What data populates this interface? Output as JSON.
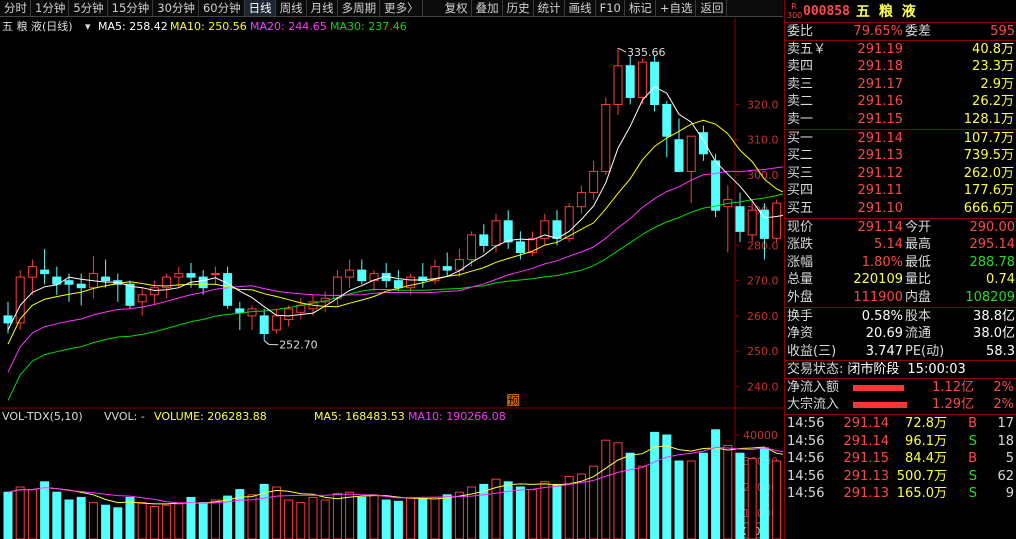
{
  "toolbar": {
    "left": [
      "分时",
      "1分钟",
      "5分钟",
      "15分钟",
      "30分钟",
      "60分钟",
      "日线",
      "周线",
      "月线",
      "多周期",
      "更多〉"
    ],
    "active": "日线",
    "right": [
      "复权",
      "叠加",
      "历史",
      "统计",
      "画线",
      "F10",
      "标记",
      "+自选",
      "返回"
    ]
  },
  "chart": {
    "header": {
      "name": "五 粮 液(日线)",
      "ma5": "MA5: 258.42",
      "ma10": "MA10: 250.56",
      "ma20": "MA20: 244.65",
      "ma30": "MA30: 237.46"
    },
    "price_ticks": [
      "320.0",
      "310.0",
      "300.0",
      "290.0",
      "280.0",
      "270.0",
      "260.0",
      "250.0",
      "240.0"
    ],
    "high_label": "335.66",
    "low_label": "252.70",
    "marker": "预",
    "volume_header": {
      "name": "VOL-TDX(5,10)",
      "vvol": "VVOL: -",
      "volume": "VOLUME: 206283.88",
      "ma5": "MA5: 168483.53",
      "ma10": "MA10: 190266.08"
    },
    "volume_ticks": [
      "40000",
      "30000",
      "20000",
      "10000"
    ],
    "volume_unit": "X10",
    "colors": {
      "up": "#ff3a3a",
      "down": "#54ffff",
      "ma5": "#ffffff",
      "ma10": "#ffff00",
      "ma20": "#ff33ff",
      "ma30": "#00dd00",
      "axis": "#8a0000"
    }
  },
  "chart_data": {
    "type": "candlestick",
    "y_price_range": [
      235,
      340
    ],
    "y_volume_range": [
      0,
      45000
    ],
    "candles": [
      {
        "o": 260,
        "h": 264,
        "l": 255,
        "c": 258,
        "v": 18000
      },
      {
        "o": 258,
        "h": 273,
        "l": 256,
        "c": 271,
        "v": 20000
      },
      {
        "o": 271,
        "h": 276,
        "l": 266,
        "c": 274,
        "v": 19000
      },
      {
        "o": 273,
        "h": 279,
        "l": 269,
        "c": 272,
        "v": 22000
      },
      {
        "o": 271,
        "h": 274,
        "l": 266,
        "c": 269,
        "v": 18000
      },
      {
        "o": 270,
        "h": 272,
        "l": 264,
        "c": 269,
        "v": 15000
      },
      {
        "o": 269,
        "h": 272,
        "l": 263,
        "c": 268,
        "v": 16000
      },
      {
        "o": 268,
        "h": 277,
        "l": 265,
        "c": 272,
        "v": 14000
      },
      {
        "o": 271,
        "h": 276,
        "l": 268,
        "c": 270,
        "v": 13000
      },
      {
        "o": 270,
        "h": 272,
        "l": 264,
        "c": 269,
        "v": 12000
      },
      {
        "o": 269,
        "h": 270,
        "l": 262,
        "c": 263,
        "v": 16000
      },
      {
        "o": 264,
        "h": 268,
        "l": 260,
        "c": 266,
        "v": 14000
      },
      {
        "o": 266,
        "h": 270,
        "l": 263,
        "c": 268,
        "v": 12500
      },
      {
        "o": 268,
        "h": 272,
        "l": 265,
        "c": 271,
        "v": 13000
      },
      {
        "o": 271,
        "h": 274,
        "l": 268,
        "c": 272,
        "v": 13500
      },
      {
        "o": 272,
        "h": 275,
        "l": 268,
        "c": 271,
        "v": 16000
      },
      {
        "o": 271,
        "h": 273,
        "l": 266,
        "c": 268,
        "v": 14000
      },
      {
        "o": 272,
        "h": 274,
        "l": 269,
        "c": 272,
        "v": 15000
      },
      {
        "o": 272,
        "h": 274,
        "l": 262,
        "c": 263,
        "v": 16500
      },
      {
        "o": 262,
        "h": 264,
        "l": 256,
        "c": 261,
        "v": 19000
      },
      {
        "o": 260,
        "h": 263,
        "l": 256,
        "c": 262,
        "v": 17000
      },
      {
        "o": 260,
        "h": 262,
        "l": 253,
        "c": 255,
        "v": 21000
      },
      {
        "o": 256,
        "h": 262,
        "l": 255,
        "c": 260,
        "v": 20000
      },
      {
        "o": 259,
        "h": 263,
        "l": 257,
        "c": 262,
        "v": 15000
      },
      {
        "o": 261,
        "h": 265,
        "l": 259,
        "c": 263,
        "v": 14000
      },
      {
        "o": 262,
        "h": 266,
        "l": 260,
        "c": 264,
        "v": 16000
      },
      {
        "o": 264,
        "h": 267,
        "l": 261,
        "c": 265,
        "v": 15000
      },
      {
        "o": 265,
        "h": 273,
        "l": 263,
        "c": 271,
        "v": 17500
      },
      {
        "o": 271,
        "h": 276,
        "l": 268,
        "c": 273,
        "v": 18000
      },
      {
        "o": 273,
        "h": 276,
        "l": 269,
        "c": 270,
        "v": 16000
      },
      {
        "o": 270,
        "h": 273,
        "l": 267,
        "c": 272,
        "v": 17000
      },
      {
        "o": 272,
        "h": 275,
        "l": 268,
        "c": 270,
        "v": 15000
      },
      {
        "o": 270,
        "h": 273,
        "l": 267,
        "c": 268,
        "v": 14500
      },
      {
        "o": 268,
        "h": 272,
        "l": 266,
        "c": 271,
        "v": 16000
      },
      {
        "o": 271,
        "h": 275,
        "l": 268,
        "c": 270,
        "v": 15500
      },
      {
        "o": 270,
        "h": 276,
        "l": 269,
        "c": 274,
        "v": 16000
      },
      {
        "o": 274,
        "h": 278,
        "l": 271,
        "c": 273,
        "v": 17000
      },
      {
        "o": 273,
        "h": 279,
        "l": 271,
        "c": 276,
        "v": 18000
      },
      {
        "o": 276,
        "h": 284,
        "l": 274,
        "c": 283,
        "v": 20000
      },
      {
        "o": 283,
        "h": 286,
        "l": 278,
        "c": 280,
        "v": 21000
      },
      {
        "o": 280,
        "h": 289,
        "l": 278,
        "c": 287,
        "v": 23000
      },
      {
        "o": 287,
        "h": 290,
        "l": 279,
        "c": 281,
        "v": 22000
      },
      {
        "o": 281,
        "h": 284,
        "l": 276,
        "c": 278,
        "v": 20000
      },
      {
        "o": 278,
        "h": 284,
        "l": 277,
        "c": 282,
        "v": 19000
      },
      {
        "o": 282,
        "h": 289,
        "l": 280,
        "c": 287,
        "v": 22000
      },
      {
        "o": 287,
        "h": 290,
        "l": 280,
        "c": 282,
        "v": 21000
      },
      {
        "o": 282,
        "h": 292,
        "l": 281,
        "c": 291,
        "v": 24000
      },
      {
        "o": 291,
        "h": 297,
        "l": 289,
        "c": 295,
        "v": 25000
      },
      {
        "o": 295,
        "h": 304,
        "l": 293,
        "c": 301,
        "v": 28000
      },
      {
        "o": 301,
        "h": 322,
        "l": 300,
        "c": 320,
        "v": 38000
      },
      {
        "o": 320,
        "h": 336,
        "l": 317,
        "c": 331,
        "v": 37000
      },
      {
        "o": 331,
        "h": 334,
        "l": 320,
        "c": 322,
        "v": 33000
      },
      {
        "o": 322,
        "h": 333,
        "l": 320,
        "c": 332,
        "v": 28000
      },
      {
        "o": 332,
        "h": 334,
        "l": 318,
        "c": 320,
        "v": 41000
      },
      {
        "o": 320,
        "h": 321,
        "l": 305,
        "c": 311,
        "v": 40000
      },
      {
        "o": 310,
        "h": 316,
        "l": 302,
        "c": 301,
        "v": 30000
      },
      {
        "o": 301,
        "h": 306,
        "l": 292,
        "c": 311,
        "v": 30000
      },
      {
        "o": 312,
        "h": 314,
        "l": 304,
        "c": 306,
        "v": 33000
      },
      {
        "o": 304,
        "h": 306,
        "l": 288,
        "c": 290,
        "v": 42000
      },
      {
        "o": 291,
        "h": 297,
        "l": 278,
        "c": 293,
        "v": 36000
      },
      {
        "o": 291,
        "h": 295,
        "l": 281,
        "c": 284,
        "v": 33000
      },
      {
        "o": 283,
        "h": 293,
        "l": 281,
        "c": 290,
        "v": 31000
      },
      {
        "o": 290,
        "h": 292,
        "l": 276,
        "c": 282,
        "v": 35000
      },
      {
        "o": 282,
        "h": 293,
        "l": 281,
        "c": 292,
        "v": 30000
      },
      {
        "o": 288,
        "h": 297,
        "l": 287,
        "c": 296,
        "v": 32000
      },
      {
        "o": 296,
        "h": 299,
        "l": 292,
        "c": 293,
        "v": 28000
      },
      {
        "o": 302,
        "h": 316,
        "l": 300,
        "c": 315,
        "v": 42000
      },
      {
        "o": 315,
        "h": 317,
        "l": 304,
        "c": 306,
        "v": 25000
      },
      {
        "o": 303,
        "h": 306,
        "l": 289,
        "c": 293,
        "v": 32000
      },
      {
        "o": 289,
        "h": 293,
        "l": 284,
        "c": 287,
        "v": 29000
      },
      {
        "o": 289,
        "h": 294,
        "l": 288,
        "c": 291,
        "v": 22000
      }
    ]
  },
  "quote": {
    "code": "000858",
    "name": "五 粮 液",
    "mark_top": "R",
    "mark_bottom": "300",
    "weibi_label": "委比",
    "weibi": "79.65%",
    "weicha_label": "委差",
    "weicha": "595",
    "asks": [
      {
        "label": "卖五￥",
        "price": "291.19",
        "vol": "40.8万"
      },
      {
        "label": "卖四",
        "price": "291.18",
        "vol": "23.3万"
      },
      {
        "label": "卖三",
        "price": "291.17",
        "vol": "2.9万"
      },
      {
        "label": "卖二",
        "price": "291.16",
        "vol": "26.2万"
      },
      {
        "label": "卖一",
        "price": "291.15",
        "vol": "128.1万"
      }
    ],
    "bids": [
      {
        "label": "买一",
        "price": "291.14",
        "vol": "107.7万"
      },
      {
        "label": "买二",
        "price": "291.13",
        "vol": "739.5万"
      },
      {
        "label": "买三",
        "price": "291.12",
        "vol": "262.0万"
      },
      {
        "label": "买四",
        "price": "291.11",
        "vol": "177.6万"
      },
      {
        "label": "买五",
        "price": "291.10",
        "vol": "666.6万"
      }
    ],
    "grid1": [
      {
        "k1": "现价",
        "v1": "291.14",
        "k2": "今开",
        "v2": "290.00"
      },
      {
        "k1": "涨跌",
        "v1": "5.14",
        "k2": "最高",
        "v2": "295.14"
      },
      {
        "k1": "涨幅",
        "v1": "1.80%",
        "k2": "最低",
        "v2": "288.78"
      },
      {
        "k1": "总量",
        "v1": "220109",
        "k2": "量比",
        "v2": "0.74"
      },
      {
        "k1": "外盘",
        "v1": "111900",
        "k2": "内盘",
        "v2": "108209"
      }
    ],
    "grid2": [
      {
        "k1": "换手",
        "v1": "0.58%",
        "k2": "股本",
        "v2": "38.8亿"
      },
      {
        "k1": "净资",
        "v1": "20.69",
        "k2": "流通",
        "v2": "38.0亿"
      },
      {
        "k1": "收益(三)",
        "v1": "3.747",
        "k2": "PE(动)",
        "v2": "58.3"
      }
    ],
    "status_label": "交易状态:",
    "status": "闭市阶段",
    "status_time": "15:00:03",
    "flows": [
      {
        "label": "净流入额",
        "value": "1.12亿",
        "pct": "2%",
        "bar": 0.95
      },
      {
        "label": "大宗流入",
        "value": "1.29亿",
        "pct": "2%",
        "bar": 1.0
      }
    ],
    "ticks": [
      {
        "time": "14:56",
        "price": "291.14",
        "vol": "72.8万",
        "side": "B",
        "n": "17"
      },
      {
        "time": "14:56",
        "price": "291.14",
        "vol": "96.1万",
        "side": "S",
        "n": "18"
      },
      {
        "time": "14:56",
        "price": "291.15",
        "vol": "84.4万",
        "side": "B",
        "n": "5"
      },
      {
        "time": "14:56",
        "price": "291.13",
        "vol": "500.7万",
        "side": "S",
        "n": "62"
      },
      {
        "time": "14:56",
        "price": "291.13",
        "vol": "165.0万",
        "side": "S",
        "n": "9"
      }
    ]
  }
}
